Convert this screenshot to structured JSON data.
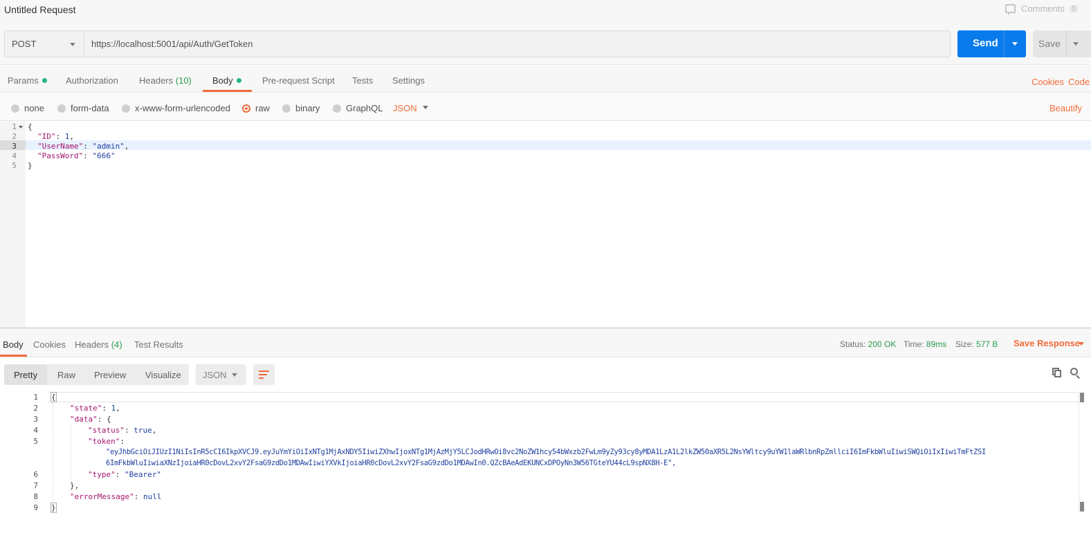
{
  "title": "Untitled Request",
  "comments": {
    "label": "Comments",
    "count": "0"
  },
  "request": {
    "method": "POST",
    "url": "https://localhost:5001/api/Auth/GetToken",
    "send_label": "Send",
    "save_label": "Save"
  },
  "request_tabs": {
    "params": "Params",
    "authorization": "Authorization",
    "headers": "Headers",
    "headers_count": "(10)",
    "body": "Body",
    "pre_request": "Pre-request Script",
    "tests": "Tests",
    "settings": "Settings",
    "cookies": "Cookies",
    "code": "Code"
  },
  "body_types": {
    "none": "none",
    "form_data": "form-data",
    "urlencoded": "x-www-form-urlencoded",
    "raw": "raw",
    "binary": "binary",
    "graphql": "GraphQL",
    "format": "JSON",
    "beautify": "Beautify"
  },
  "request_body": {
    "line_numbers": [
      "1",
      "2",
      "3",
      "4",
      "5"
    ],
    "open_brace": "{",
    "close_brace": "}",
    "fields": [
      {
        "key": "\"ID\"",
        "value": "1",
        "suffix": ","
      },
      {
        "key": "\"UserName\"",
        "value": "\"admin\"",
        "suffix": ","
      },
      {
        "key": "\"PassWord\"",
        "value": "\"666\"",
        "suffix": ""
      }
    ]
  },
  "response_tabs": {
    "body": "Body",
    "cookies": "Cookies",
    "headers": "Headers",
    "headers_count": "(4)",
    "test_results": "Test Results"
  },
  "response_meta": {
    "status_label": "Status:",
    "status_value": "200 OK",
    "time_label": "Time:",
    "time_value": "89ms",
    "size_label": "Size:",
    "size_value": "577 B",
    "save_response": "Save Response"
  },
  "response_view": {
    "pretty": "Pretty",
    "raw": "Raw",
    "preview": "Preview",
    "visualize": "Visualize",
    "format": "JSON"
  },
  "response_body": {
    "line_numbers": [
      "1",
      "2",
      "3",
      "4",
      "5",
      "6",
      "7",
      "8",
      "9"
    ],
    "open_brace": "{",
    "close_brace": "}",
    "state_key": "\"state\"",
    "state_value": "1",
    "data_key": "\"data\"",
    "status_key": "\"status\"",
    "status_value": "true",
    "token_key": "\"token\"",
    "token_line1": "\"eyJhbGciOiJIUzI1NiIsInR5cCI6IkpXVCJ9.eyJuYmYiOiIxNTg1MjAxNDY5IiwiZXhwIjoxNTg1MjAzMjY5LCJodHRwOi8vc2NoZW1hcy54bWxzb2FwLm9yZy93cy8yMDA1LzA1L2lkZW50aXR5L2NsYWltcy9uYW1laWRlbnRpZmllciI6ImFkbWluIiwiSWQiOiIxIiwiTmFtZSI",
    "token_line2": "6ImFkbWluIiwiaXNzIjoiaHR0cDovL2xvY2FsaG9zdDo1MDAwIiwiYXVkIjoiaHR0cDovL2xvY2FsaG9zdDo1MDAwIn0.QZcBAeAdEKUNCxDPOyNn3W56TGteYU44cL9spNX8H-E\",",
    "type_key": "\"type\"",
    "type_value": "\"Bearer\"",
    "data_close": "},",
    "error_key": "\"errorMessage\"",
    "error_value": "null"
  }
}
